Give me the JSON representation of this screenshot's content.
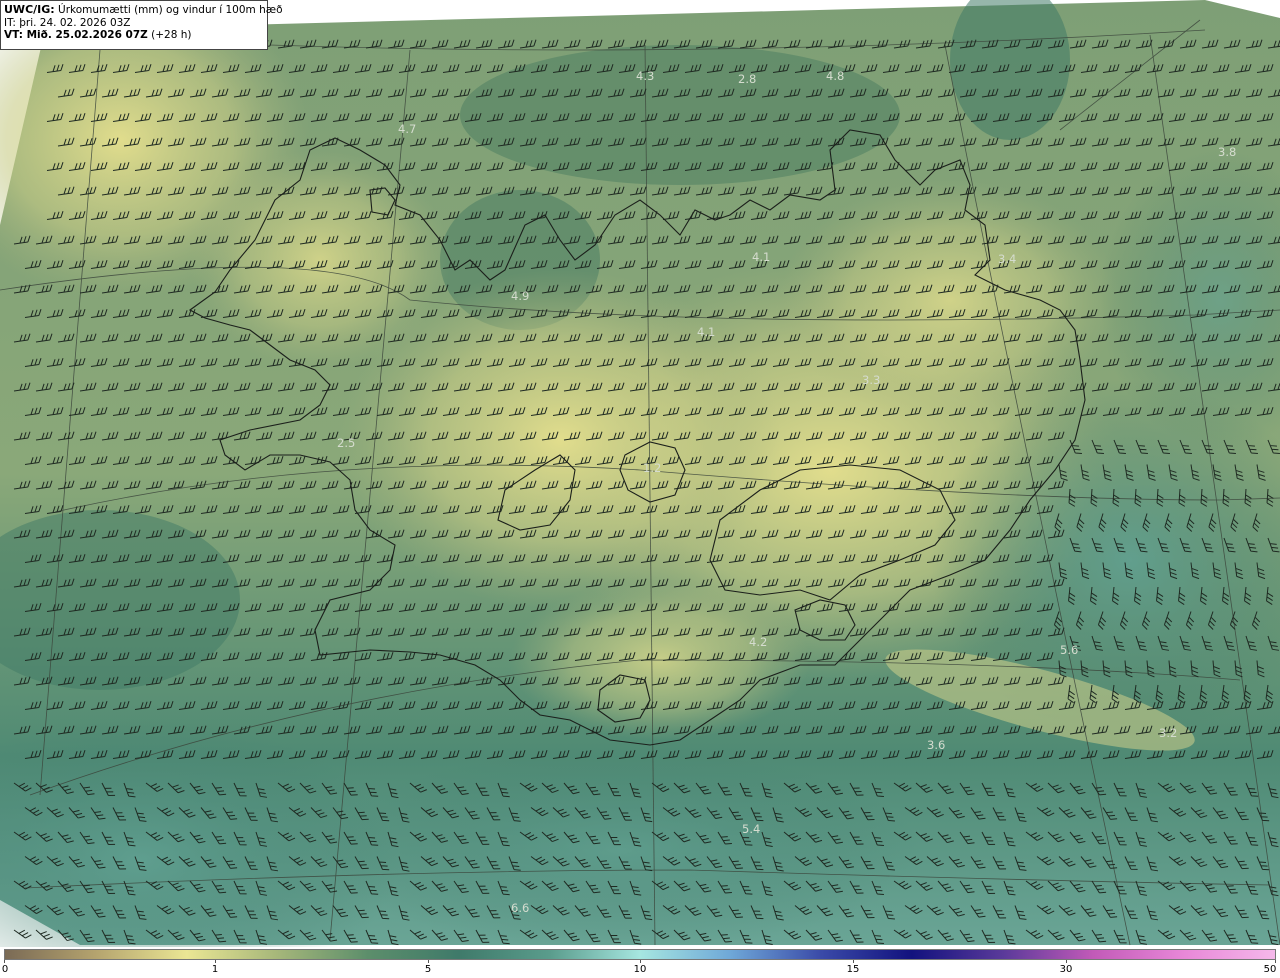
{
  "header": {
    "model": "UWC/IG:",
    "title": "Úrkomumætti (mm) og vindur í 100m hæð",
    "init_time": "IT: þri. 24. 02. 2026 03Z",
    "valid_prefix": "VT: Mið. 25.02.2026 07Z",
    "valid_suffix": "(+28 h)"
  },
  "map_labels": [
    {
      "text": "4.3"
    },
    {
      "text": "2.8"
    },
    {
      "text": "4.8"
    },
    {
      "text": "4.7"
    },
    {
      "text": "3.8"
    },
    {
      "text": "4.1"
    },
    {
      "text": "3.4"
    },
    {
      "text": "4.9"
    },
    {
      "text": "4.1"
    },
    {
      "text": "3.3"
    },
    {
      "text": "2.5"
    },
    {
      "text": "1.2"
    },
    {
      "text": "4.2"
    },
    {
      "text": "5.6"
    },
    {
      "text": "3.6"
    },
    {
      "text": "3.2"
    },
    {
      "text": "5.4"
    },
    {
      "text": "6.6"
    }
  ],
  "colorbar": {
    "ticks": [
      "0",
      "1",
      "5",
      "10",
      "15",
      "30",
      "50"
    ],
    "colors": [
      "#7a6a55",
      "#b4a36e",
      "#eae694",
      "#a6b77a",
      "#5c8e6b",
      "#3f7a6a",
      "#5a9c8c",
      "#a6e6e0",
      "#6fa8d8",
      "#3a4aa8",
      "#12127e",
      "#5a3a9a",
      "#c25ab8",
      "#e888d8",
      "#f5b8ea"
    ]
  }
}
